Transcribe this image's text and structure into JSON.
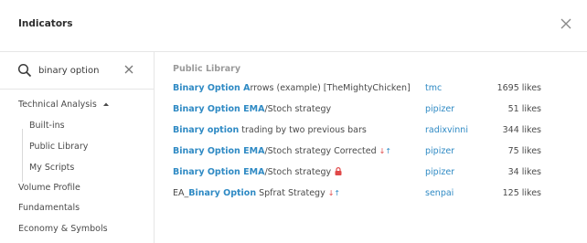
{
  "header": {
    "title": "Indicators"
  },
  "search": {
    "value": "binary option"
  },
  "sidebar": {
    "technical_analysis": "Technical Analysis",
    "sub_items": [
      "Built-ins",
      "Public Library",
      "My Scripts"
    ],
    "items": [
      "Volume Profile",
      "Fundamentals",
      "Economy & Symbols"
    ]
  },
  "main": {
    "section_title": "Public Library",
    "rows": [
      {
        "pre": "",
        "hl": "Binary Option ",
        "hl2": "A",
        "rest": "rrows (example) [TheMightyChicken]",
        "author": "tmc",
        "likes": "1695 likes",
        "badge": ""
      },
      {
        "pre": "",
        "hl": "Binary Option ",
        "hl2": "EMA",
        "rest": "/Stoch strategy",
        "author": "pipizer",
        "likes": "51 likes",
        "badge": ""
      },
      {
        "pre": "",
        "hl": "Binary option",
        "hl2": "",
        "rest": " trading by two previous bars",
        "author": "radixvinni",
        "likes": "344 likes",
        "badge": ""
      },
      {
        "pre": "",
        "hl": "Binary Option ",
        "hl2": "EMA",
        "rest": "/Stoch strategy Corrected",
        "author": "pipizer",
        "likes": "75 likes",
        "badge": "arrows"
      },
      {
        "pre": "",
        "hl": "Binary Option ",
        "hl2": "EMA",
        "rest": "/Stoch strategy",
        "author": "pipizer",
        "likes": "34 likes",
        "badge": "lock"
      },
      {
        "pre": "EA_",
        "hl": "Binary Option",
        "hl2": "",
        "rest": " Spfrat Strategy",
        "author": "senpai",
        "likes": "125 likes",
        "badge": "arrows"
      }
    ]
  },
  "icons": {
    "close": "close-icon",
    "search": "search-icon",
    "clear": "clear-icon",
    "caret": "caret-up-icon",
    "lock": "lock-icon",
    "arrows": "down-up-arrows-icon"
  },
  "colors": {
    "accent": "#2f8ac4",
    "down": "#e04848"
  }
}
